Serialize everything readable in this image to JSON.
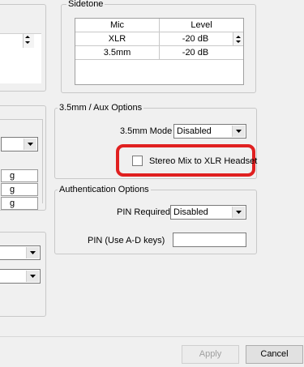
{
  "sidetone": {
    "legend": "Sidetone",
    "headers": {
      "mic": "Mic",
      "level": "Level"
    },
    "rows": [
      {
        "mic": "XLR",
        "level": "-20 dB"
      },
      {
        "mic": "3.5mm",
        "level": "-20 dB"
      }
    ]
  },
  "aux": {
    "legend": "3.5mm / Aux Options",
    "mode_label": "3.5mm Mode",
    "mode_value": "Disabled",
    "stereo_mix_label": "Stereo Mix to XLR Headset",
    "stereo_mix_checked": false,
    "highlight_color": "#e02020"
  },
  "auth": {
    "legend": "Authentication Options",
    "pin_required_label": "PIN Required",
    "pin_required_value": "Disabled",
    "pin_label": "PIN (Use A-D keys)",
    "pin_value": ""
  },
  "left_partial": {
    "rows": [
      "g",
      "g",
      "g"
    ]
  },
  "footer": {
    "apply_label": "Apply",
    "cancel_label": "Cancel"
  }
}
